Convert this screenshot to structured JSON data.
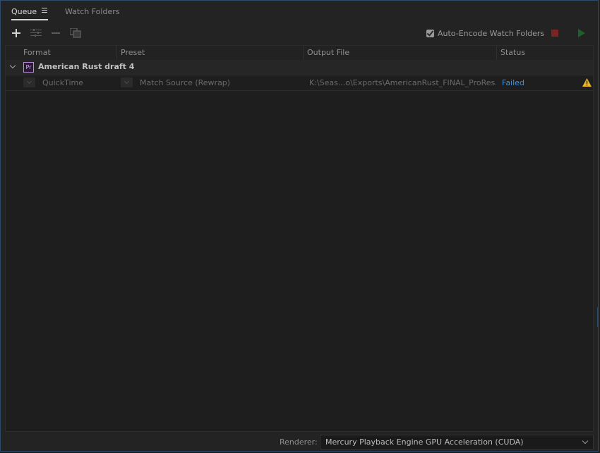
{
  "tabs": {
    "queue_label": "Queue",
    "watch_folders_label": "Watch Folders"
  },
  "toolbar": {
    "add_icon": "plus-icon",
    "settings_icon": "sliders-icon",
    "remove_icon": "minus-icon",
    "duplicate_icon": "duplicate-icon",
    "auto_encode_label": "Auto-Encode Watch Folders",
    "auto_encode_checked": true,
    "stop_color": "#7a2424",
    "start_color": "#1f5f2a"
  },
  "table": {
    "columns": [
      "Format",
      "Preset",
      "Output File",
      "Status"
    ],
    "group": {
      "app_badge": "Pr",
      "name": "American Rust draft 4"
    },
    "items": [
      {
        "format": "QuickTime",
        "preset": "Match Source (Rewrap)",
        "output_file": "K:\\Seas...o\\Exports\\AmericanRust_FINAL_ProRes.mov",
        "status": "Failed",
        "status_color": "#3d8fe0",
        "status_icon": "warning-icon"
      }
    ]
  },
  "footer": {
    "renderer_label": "Renderer:",
    "renderer_value": "Mercury Playback Engine GPU Acceleration (CUDA)"
  },
  "colors": {
    "accent_border": "#2b4c6b",
    "warning": "#e8b923",
    "premiere_purple": "#b98bd8"
  }
}
